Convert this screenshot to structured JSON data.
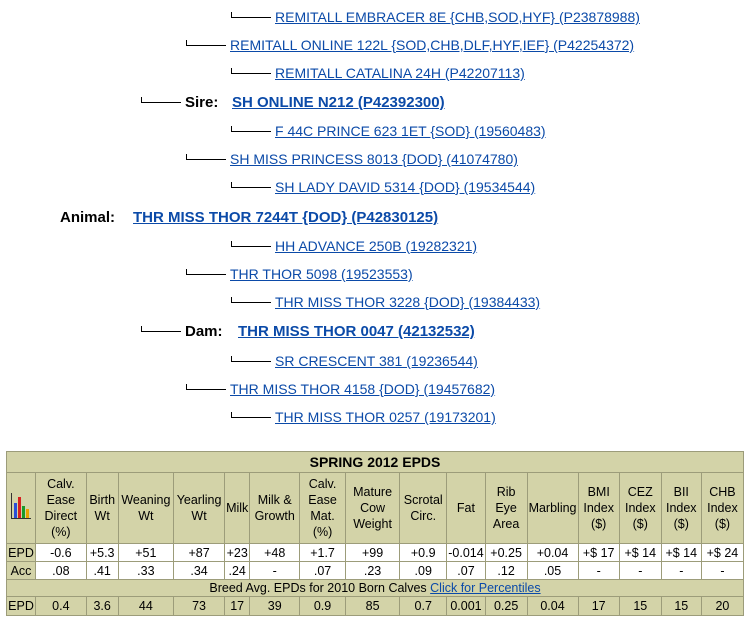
{
  "pedigree": {
    "sss": "REMITALL EMBRACER 8E {CHB,SOD,HYF} (P23878988)",
    "ss": "REMITALL ONLINE 122L {SOD,CHB,DLF,HYF,IEF} (P42254372)",
    "ssd": "REMITALL CATALINA 24H (P42207113)",
    "sire_label": "Sire:",
    "sire": "SH ONLINE N212 (P42392300)",
    "sds": "F 44C PRINCE 623 1ET {SOD} (19560483)",
    "sd": "SH MISS PRINCESS 8013 {DOD} (41074780)",
    "sdd": "SH LADY DAVID 5314 {DOD} (19534544)",
    "animal_label": "Animal:",
    "animal": "THR MISS THOR 7244T {DOD} (P42830125)",
    "dss": "HH ADVANCE 250B (19282321)",
    "ds": "THR THOR 5098 (19523553)",
    "dsd": "THR MISS THOR 3228 {DOD} (19384433)",
    "dam_label": "Dam:",
    "dam": "THR MISS THOR 0047 (42132532)",
    "dds": "SR CRESCENT 381 (19236544)",
    "dd": "THR MISS THOR 4158 {DOD} (19457682)",
    "ddd": "THR MISS THOR 0257 (19173201)"
  },
  "epd_table": {
    "title": "SPRING 2012 EPDS",
    "icon": "bar-chart-icon",
    "headers": [
      "Calv. Ease Direct (%)",
      "Birth Wt",
      "Weaning Wt",
      "Yearling Wt",
      "Milk",
      "Milk & Growth",
      "Calv. Ease Mat. (%)",
      "Mature Cow Weight",
      "Scrotal Circ.",
      "Fat",
      "Rib Eye Area",
      "Marbling",
      "BMI Index ($)",
      "CEZ Index ($)",
      "BII Index ($)",
      "CHB Index ($)"
    ],
    "epd_label": "EPD",
    "epd_values": [
      "-0.6",
      "+5.3",
      "+51",
      "+87",
      "+23",
      "+48",
      "+1.7",
      "+99",
      "+0.9",
      "-0.014",
      "+0.25",
      "+0.04",
      "+$ 17",
      "+$ 14",
      "+$ 14",
      "+$ 24"
    ],
    "acc_label": "Acc",
    "acc_values": [
      ".08",
      ".41",
      ".33",
      ".34",
      ".24",
      "-",
      ".07",
      ".23",
      ".09",
      ".07",
      ".12",
      ".05",
      "-",
      "-",
      "-",
      "-"
    ],
    "breed_avg_text": "Breed Avg. EPDs for 2010 Born Calves",
    "percentiles_link": "Click for Percentiles",
    "breed_label": "EPD",
    "breed_values": [
      "0.4",
      "3.6",
      "44",
      "73",
      "17",
      "39",
      "0.9",
      "85",
      "0.7",
      "0.001",
      "0.25",
      "0.04",
      "17",
      "15",
      "15",
      "20"
    ]
  },
  "colors": {
    "link": "#0b4aa8",
    "table_bg": "#d3d3a8",
    "cell_bg": "#ffffff"
  }
}
